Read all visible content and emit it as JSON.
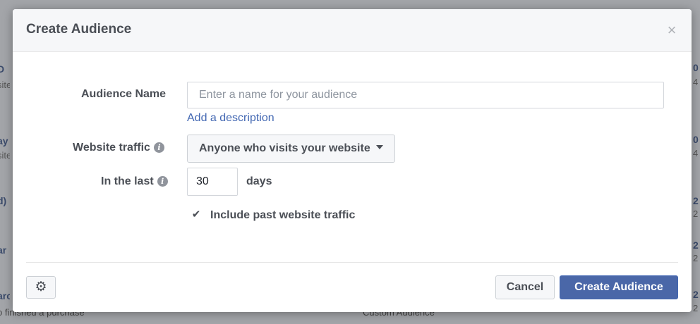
{
  "background": {
    "left_fragments": [
      {
        "text": "D",
        "sub": "site"
      },
      {
        "text": "ay",
        "sub": "site"
      },
      {
        "text": "d)",
        "sub": ""
      },
      {
        "text": "ar",
        "sub": ""
      },
      {
        "text": "arc",
        "sub": ""
      }
    ],
    "right_fragments": [
      "0",
      "4",
      "0",
      "4",
      "2",
      "2",
      "2",
      "2",
      "2",
      "2"
    ],
    "bottom_left": "o finished a purchase",
    "bottom_center": "Custom Audience"
  },
  "dialog": {
    "title": "Create Audience",
    "close_glyph": "×"
  },
  "form": {
    "audience_name_label": "Audience Name",
    "audience_name_placeholder": "Enter a name for your audience",
    "audience_name_value": "",
    "add_description": "Add a description",
    "website_traffic_label": "Website traffic",
    "website_traffic_value": "Anyone who visits your website",
    "in_the_last_label": "In the last",
    "days_value": "30",
    "days_unit": "days",
    "include_past_checked": true,
    "include_past_label": "Include past website traffic",
    "info_glyph": "i"
  },
  "footer": {
    "settings_icon": "gear-icon",
    "cancel_label": "Cancel",
    "create_label": "Create Audience"
  },
  "colors": {
    "primary_button": "#4a67a8",
    "link": "#4267b2",
    "overlay": "#a3a5a9"
  }
}
